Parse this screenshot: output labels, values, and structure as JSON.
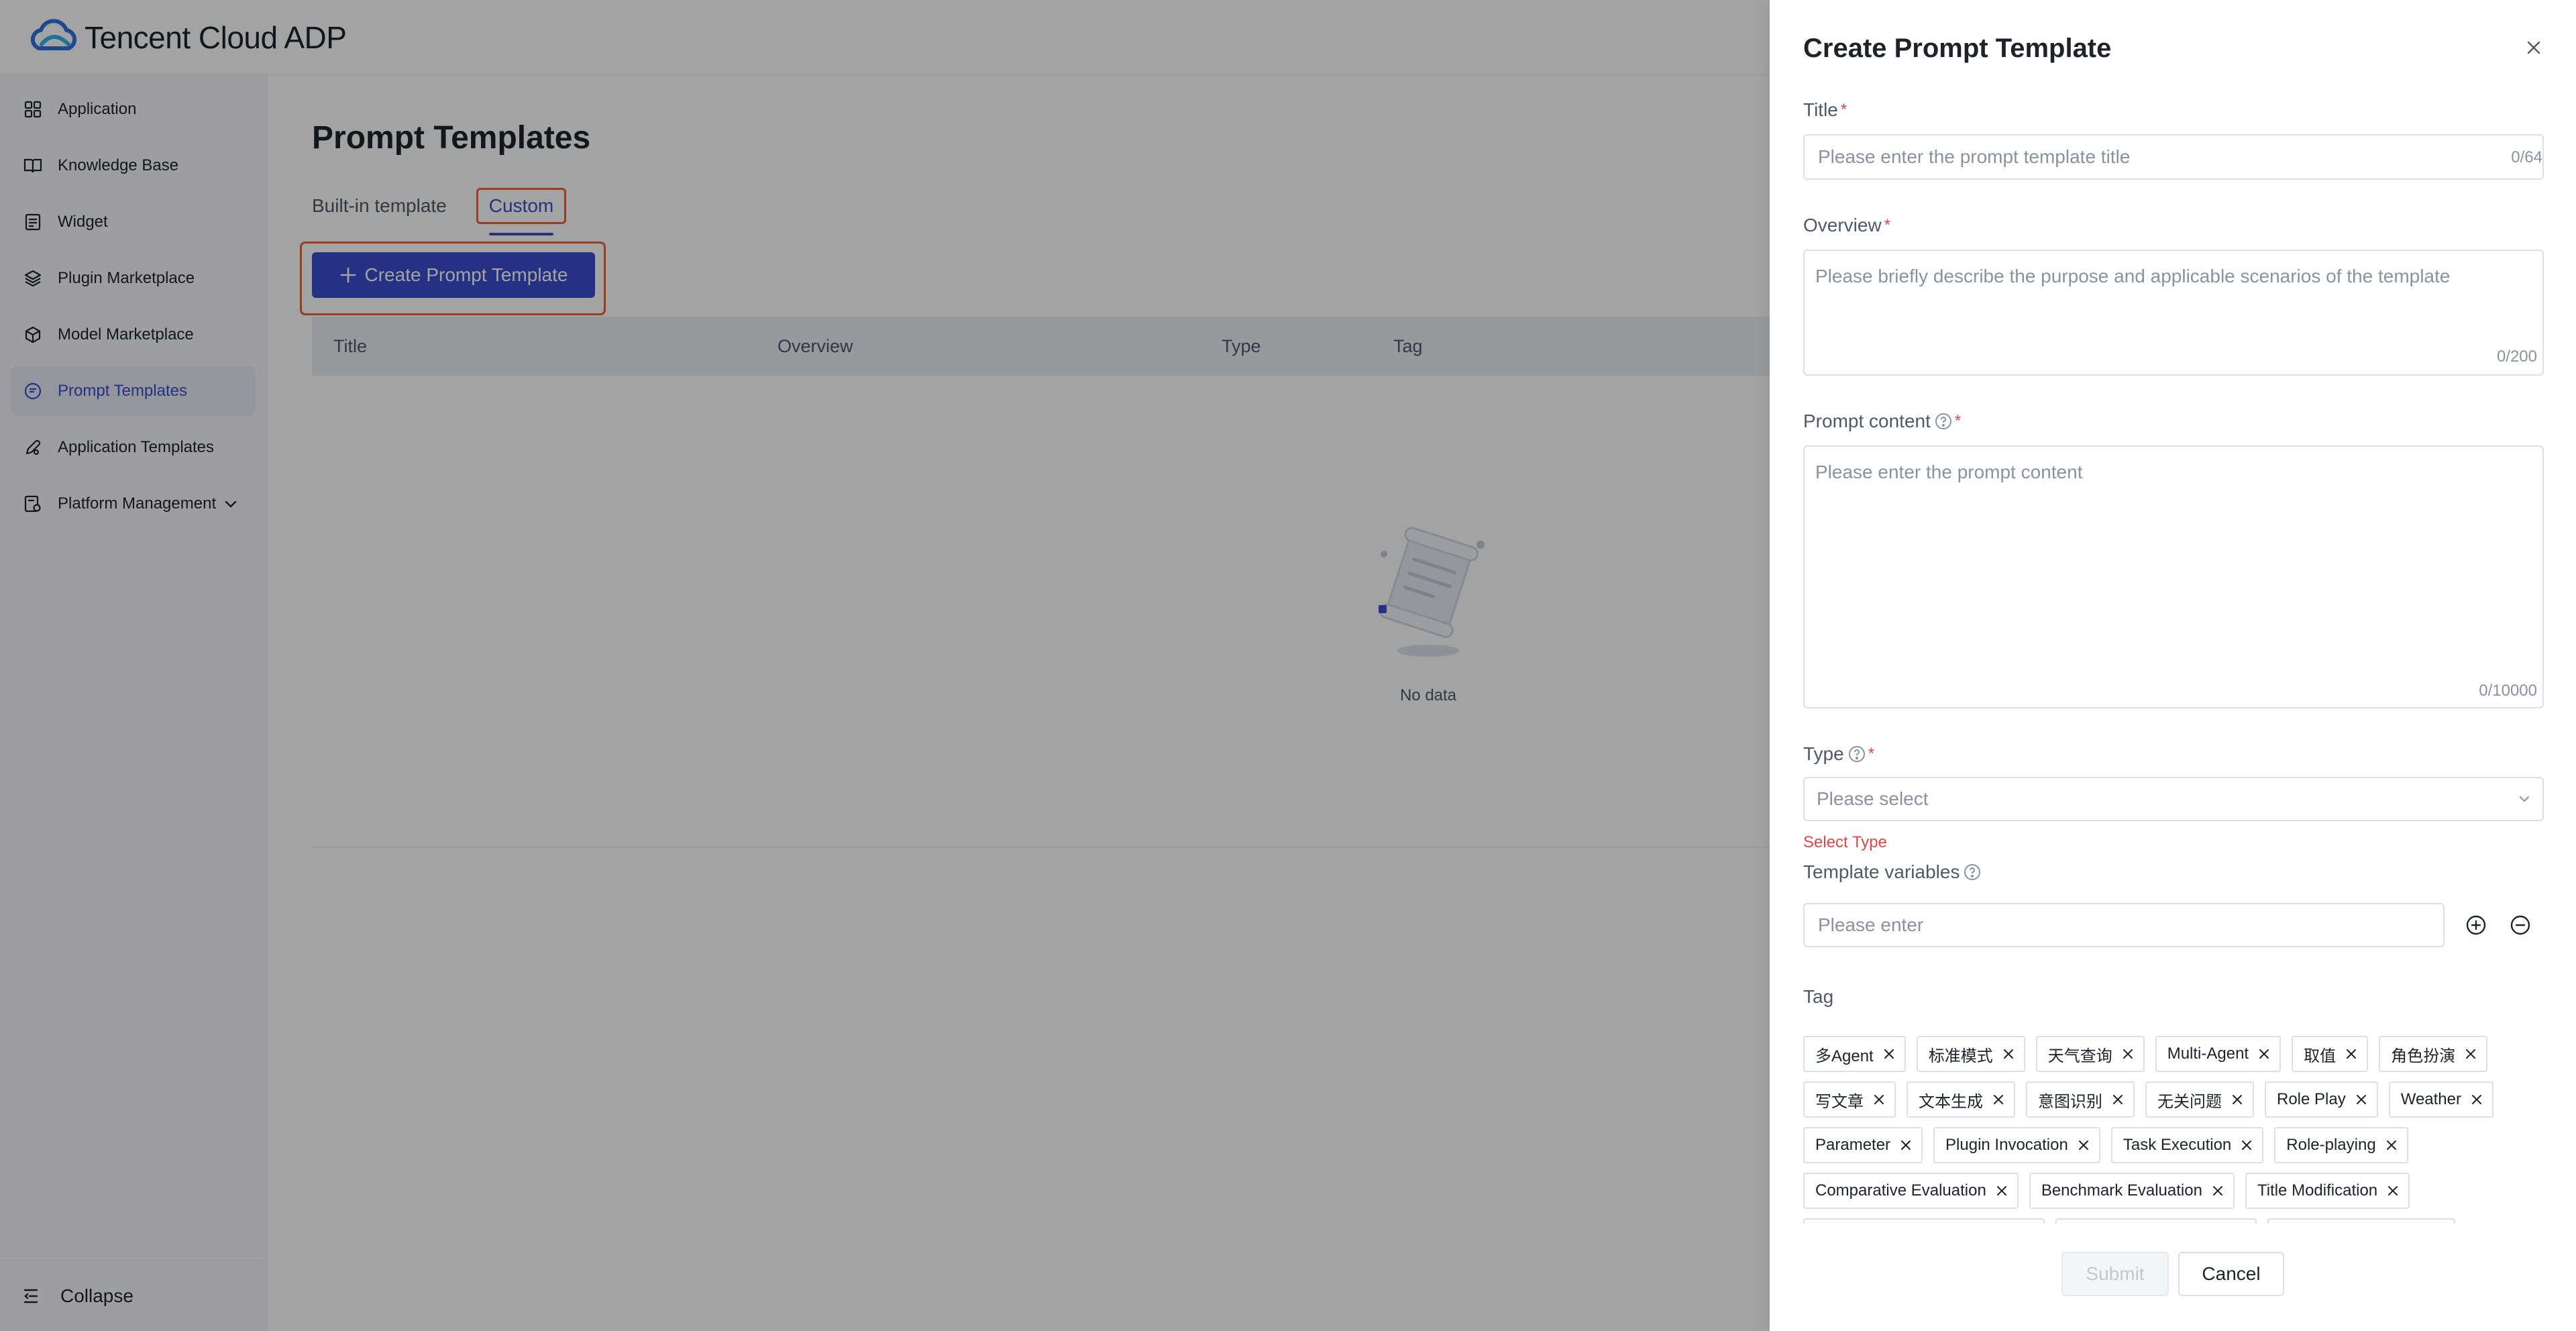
{
  "app": {
    "title": "Tencent Cloud ADP"
  },
  "sidebar": {
    "items": [
      {
        "label": "Application",
        "icon": "grid-icon"
      },
      {
        "label": "Knowledge Base",
        "icon": "book-icon"
      },
      {
        "label": "Widget",
        "icon": "widget-icon"
      },
      {
        "label": "Plugin Marketplace",
        "icon": "layers-icon"
      },
      {
        "label": "Model Marketplace",
        "icon": "cube-icon"
      },
      {
        "label": "Prompt Templates",
        "icon": "prompt-icon",
        "active": true
      },
      {
        "label": "Application Templates",
        "icon": "pen-icon"
      },
      {
        "label": "Platform Management",
        "icon": "settings-doc-icon",
        "expandable": true
      }
    ],
    "collapse_label": "Collapse"
  },
  "main": {
    "page_title": "Prompt Templates",
    "tabs": [
      {
        "label": "Built-in template"
      },
      {
        "label": "Custom",
        "active": true
      }
    ],
    "create_button": "Create Prompt Template",
    "table": {
      "columns": [
        "Title",
        "Overview",
        "Type",
        "Tag"
      ]
    },
    "empty_text": "No data"
  },
  "drawer": {
    "title": "Create Prompt Template",
    "fields": {
      "title": {
        "label": "Title",
        "placeholder": "Please enter the prompt template title",
        "counter": "0/64"
      },
      "overview": {
        "label": "Overview",
        "placeholder": "Please briefly describe the purpose and applicable scenarios of the template",
        "counter": "0/200"
      },
      "prompt": {
        "label": "Prompt content",
        "placeholder": "Please enter the prompt content",
        "counter": "0/10000"
      },
      "type": {
        "label": "Type",
        "placeholder": "Please select",
        "error": "Select Type"
      },
      "variables": {
        "label": "Template variables",
        "placeholder": "Please enter"
      },
      "tag": {
        "label": "Tag"
      }
    },
    "tag_rows": [
      [
        "多Agent",
        "标准模式",
        "天气查询",
        "Multi-Agent",
        "取值",
        "角色扮演"
      ],
      [
        "写文章",
        "文本生成",
        "意图识别",
        "无关问题",
        "Role Play",
        "Weather"
      ],
      [
        "Parameter",
        "Plugin Invocation",
        "Task Execution",
        "Role-playing"
      ],
      [
        "Comparative Evaluation",
        "Benchmark Evaluation",
        "Title Modification"
      ]
    ],
    "submit_label": "Submit",
    "cancel_label": "Cancel"
  },
  "colors": {
    "accent": "#3a4fce",
    "highlight": "#e8613c",
    "required": "#e54545"
  }
}
